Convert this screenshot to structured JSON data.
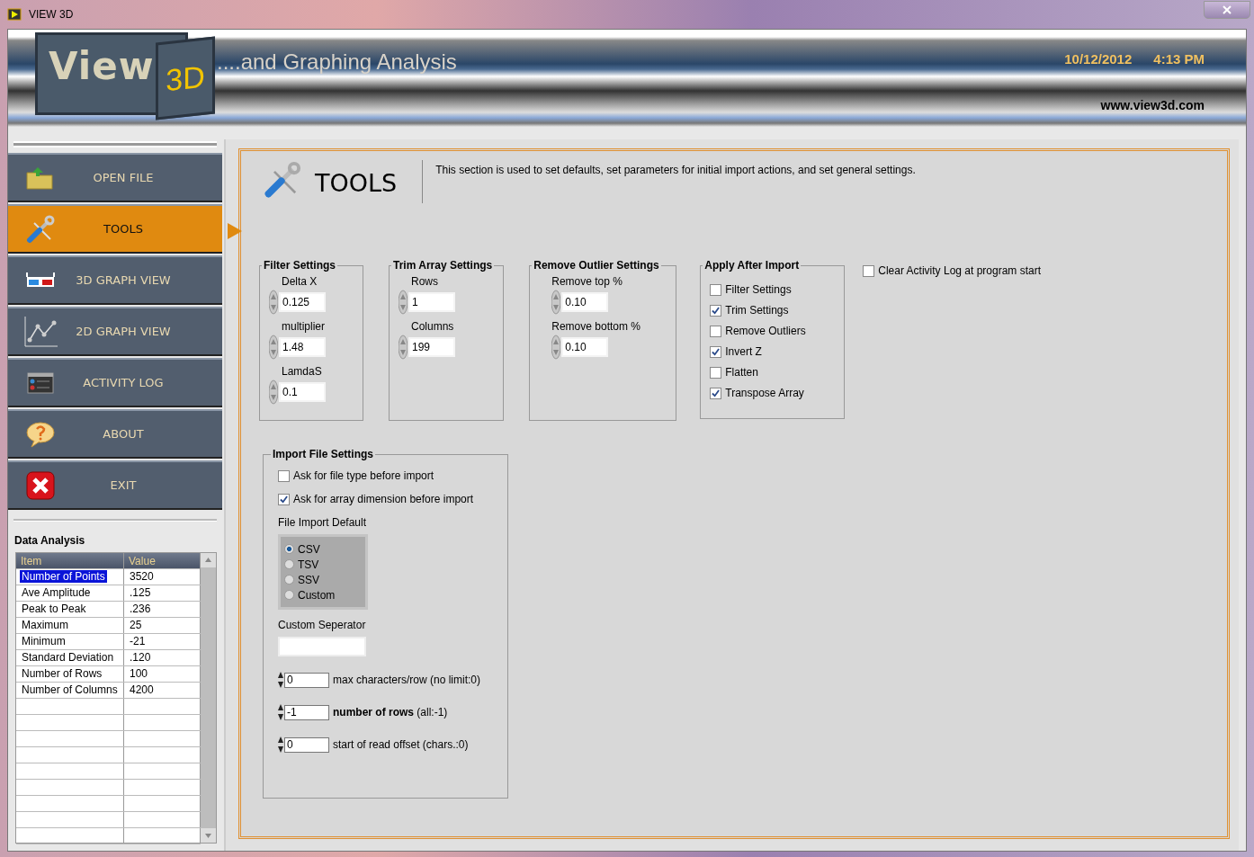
{
  "window": {
    "title": "VIEW 3D"
  },
  "header": {
    "logo_word": "View",
    "logo_badge": "3D",
    "tagline": "....and Graphing Analysis",
    "date": "10/12/2012",
    "time": "4:13 PM",
    "website": "www.view3d.com"
  },
  "nav": [
    {
      "label": "OPEN FILE",
      "kind": "folder",
      "selected": false
    },
    {
      "label": "TOOLS",
      "kind": "tools",
      "selected": true
    },
    {
      "label": "3D GRAPH VIEW",
      "kind": "glasses",
      "selected": false
    },
    {
      "label": "2D GRAPH VIEW",
      "kind": "graph",
      "selected": false
    },
    {
      "label": "ACTIVITY LOG",
      "kind": "log",
      "selected": false
    },
    {
      "label": "ABOUT",
      "kind": "help",
      "selected": false
    },
    {
      "label": "EXIT",
      "kind": "exit",
      "selected": false
    }
  ],
  "data_analysis": {
    "title": "Data Analysis",
    "columns": [
      "Item",
      "Value"
    ],
    "rows": [
      {
        "item": "Number of Points",
        "value": "3520",
        "selected": true
      },
      {
        "item": "Ave Amplitude",
        "value": ".125",
        "selected": false
      },
      {
        "item": "Peak to Peak",
        "value": ".236",
        "selected": false
      },
      {
        "item": "Maximum",
        "value": "25",
        "selected": false
      },
      {
        "item": "Minimum",
        "value": "-21",
        "selected": false
      },
      {
        "item": "Standard Deviation",
        "value": ".120",
        "selected": false
      },
      {
        "item": "Number of Rows",
        "value": "100",
        "selected": false
      },
      {
        "item": "Number of Columns",
        "value": "4200",
        "selected": false
      }
    ]
  },
  "tools": {
    "title": "TOOLS",
    "description": "This section is used to set defaults, set parameters for initial import actions, and set general settings."
  },
  "groups": [
    {
      "title": "Filter Settings",
      "fields": [
        {
          "label": "Delta X",
          "value": "0.125"
        },
        {
          "label": "multiplier",
          "value": "1.48"
        },
        {
          "label": "LamdaS",
          "value": "0.1"
        }
      ]
    },
    {
      "title": "Trim Array Settings",
      "fields": [
        {
          "label": "Rows",
          "value": "1"
        },
        {
          "label": "Columns",
          "value": "199"
        }
      ]
    },
    {
      "title": "Remove Outlier Settings",
      "fields": [
        {
          "label": "Remove top %",
          "value": "0.10"
        },
        {
          "label": "Remove bottom %",
          "value": "0.10"
        }
      ]
    }
  ],
  "apply_after_import": {
    "title": "Apply After Import",
    "options": [
      {
        "label": "Filter Settings",
        "checked": false
      },
      {
        "label": "Trim Settings",
        "checked": true
      },
      {
        "label": "Remove Outliers",
        "checked": false
      },
      {
        "label": "Invert Z",
        "checked": true
      },
      {
        "label": "Flatten",
        "checked": false
      },
      {
        "label": "Transpose Array",
        "checked": true
      }
    ]
  },
  "clear_log": {
    "label": "Clear Activity Log at program start",
    "checked": false
  },
  "import_settings": {
    "title": "Import File Settings",
    "checks": [
      {
        "label": "Ask for file type before import",
        "checked": false
      },
      {
        "label": "Ask for array dimension before import",
        "checked": true
      }
    ],
    "default_label": "File Import Default",
    "formats": [
      {
        "label": "CSV",
        "selected": true
      },
      {
        "label": "TSV",
        "selected": false
      },
      {
        "label": "SSV",
        "selected": false
      },
      {
        "label": "Custom",
        "selected": false
      }
    ],
    "separator_label": "Custom Seperator",
    "numerics": [
      {
        "value": "0",
        "label": "max characters/row (no limit:0)"
      },
      {
        "value": "-1",
        "label": "**number of rows** (all:-1)"
      },
      {
        "value": "0",
        "label": "start of read offset (chars.:0)"
      }
    ]
  }
}
